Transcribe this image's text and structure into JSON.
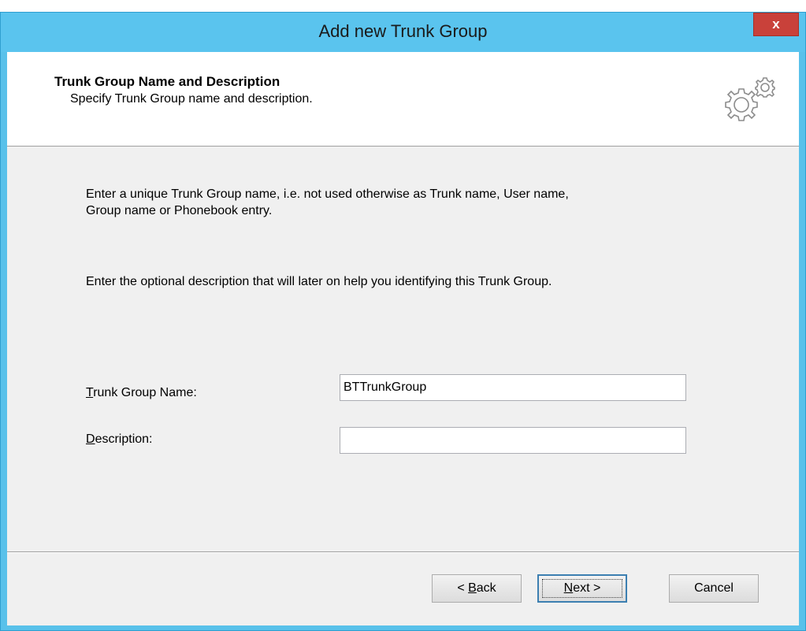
{
  "window": {
    "title": "Add new Trunk Group",
    "close_label": "x"
  },
  "header": {
    "title": "Trunk Group Name and Description",
    "subtitle": "Specify Trunk Group name and description.",
    "icon": "gears-icon"
  },
  "body": {
    "paragraph1_line1": "Enter a unique Trunk Group name, i.e. not used otherwise as Trunk name, User name,",
    "paragraph1_line2": "Group name or Phonebook entry.",
    "paragraph2": "Enter the optional description that will later on help you identifying this Trunk Group."
  },
  "fields": {
    "name_label_first": "T",
    "name_label_rest": "runk Group Name:",
    "name_value": "BTTrunkGroup",
    "description_label_first": "D",
    "description_label_rest": "escription:",
    "description_value": ""
  },
  "buttons": {
    "back_prefix": "< ",
    "back_accel": "B",
    "back_rest": "ack",
    "next_accel": "N",
    "next_rest": "ext >",
    "cancel": "Cancel"
  },
  "colors": {
    "titlebar": "#5ac4ee",
    "close_button": "#c9413a",
    "client_background": "#f0f0f0"
  }
}
